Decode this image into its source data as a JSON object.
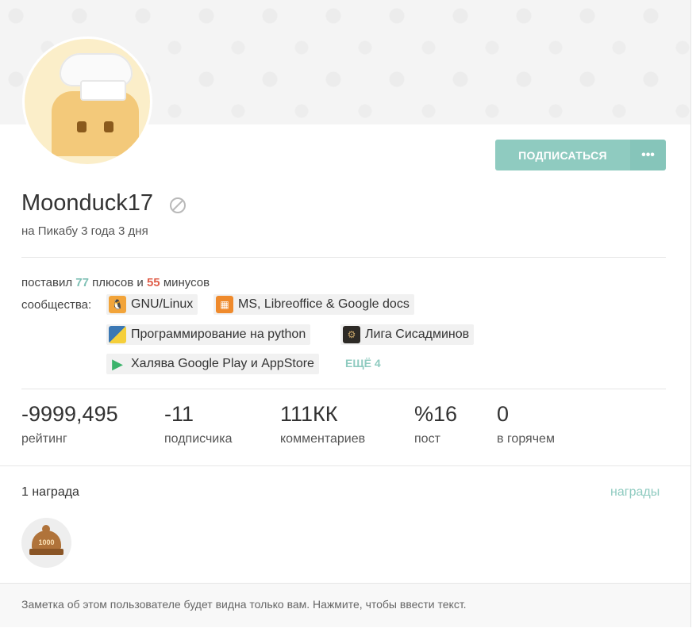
{
  "profile": {
    "username": "Moonduck17",
    "since": "на Пикабу 3 года 3 дня",
    "subscribe_label": "ПОДПИСАТЬСЯ",
    "more_label": "•••"
  },
  "votes": {
    "prefix": "поставил",
    "plus_count": "77",
    "plus_word": "плюсов и",
    "minus_count": "55",
    "minus_word": "минусов"
  },
  "communities": {
    "label": "сообщества:",
    "items": [
      {
        "name": "GNU/Linux",
        "icon": "penguin-icon"
      },
      {
        "name": "MS, Libreoffice & Google docs",
        "icon": "office-icon"
      },
      {
        "name": "Программирование на python",
        "icon": "python-icon"
      },
      {
        "name": "Лига Сисадминов",
        "icon": "sysadmin-icon"
      },
      {
        "name": "Халява Google Play и AppStore",
        "icon": "play-icon"
      }
    ],
    "more_label": "ЕЩЁ 4"
  },
  "stats": [
    {
      "value": "-9999,495",
      "label": "рейтинг"
    },
    {
      "value": "-11",
      "label": "подписчика"
    },
    {
      "value": "111КК",
      "label": "комментариев"
    },
    {
      "value": "%16",
      "label": "пост"
    },
    {
      "value": "0",
      "label": "в горячем"
    }
  ],
  "awards": {
    "count_label": "1 награда",
    "link_label": "награды",
    "medal_text": "1000"
  },
  "note": {
    "text": "Заметка об этом пользователе будет видна только вам. Нажмите, чтобы ввести текст."
  },
  "colors": {
    "accent": "#8fcbc0",
    "minus": "#e0604c"
  }
}
